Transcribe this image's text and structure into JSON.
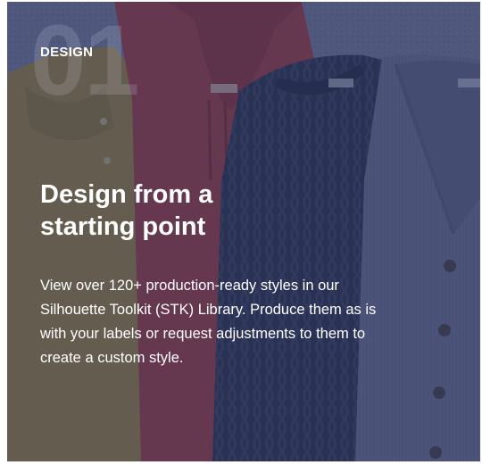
{
  "card": {
    "background_number": "01",
    "eyebrow": "DESIGN",
    "title": "Design from a starting point",
    "body": "View over 120+ production-ready styles in our Silhouette Toolkit (STK) Library. Produce them as is with your labels or request adjustments to them to create a custom style.",
    "image_subject": "garments-photo",
    "colors": {
      "overlay": "#303a64",
      "mustard_garment": "#8a7640",
      "red_hoodie": "#8e3842",
      "navy_sweater": "#27304c",
      "grey_cardigan": "#5a6183",
      "text": "#ffffff"
    }
  }
}
